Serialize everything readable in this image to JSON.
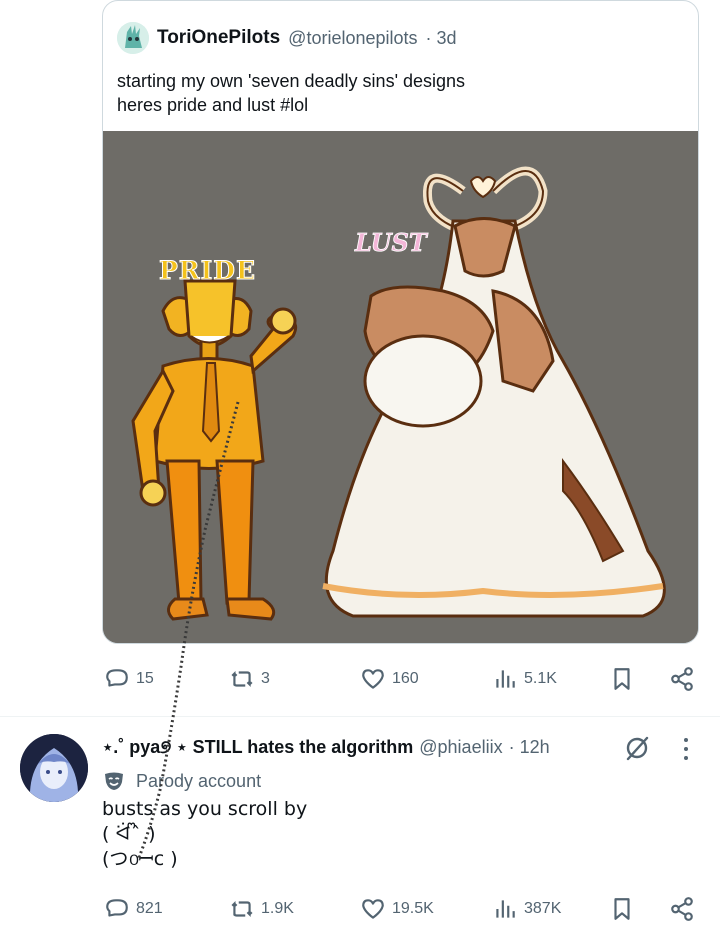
{
  "quote": {
    "name": "ToriOnePilots",
    "handle": "@torielonepilots",
    "time": "· 3d",
    "text": "starting my own 'seven deadly sins' designs\nheres pride and lust #lol",
    "media": {
      "pride_label": "PRIDE",
      "lust_label": "LUST"
    }
  },
  "quote_actions": {
    "replies": "15",
    "reposts": "3",
    "likes": "160",
    "views": "5.1K"
  },
  "reply": {
    "name": "⋆.˚ pya୭ ⋆ STILL hates the algorithm",
    "handle": "@phiaeliix",
    "time": "· 12h",
    "parody_label": "Parody account",
    "text": "busts as you scroll by\n( ᐛ ᩚ ̀ ​)\n(つ൦ꟷc )"
  },
  "reply_actions": {
    "replies": "821",
    "reposts": "1.9K",
    "likes": "19.5K",
    "views": "387K"
  },
  "colors": {
    "text": "#0f1419",
    "secondary": "#536471",
    "border": "#cfd9de",
    "media_bg": "#6e6c67"
  },
  "icons": [
    "reply-icon",
    "repost-icon",
    "like-icon",
    "views-icon",
    "bookmark-icon",
    "share-icon",
    "grok-icon",
    "more-icon",
    "parody-mask-icon"
  ]
}
